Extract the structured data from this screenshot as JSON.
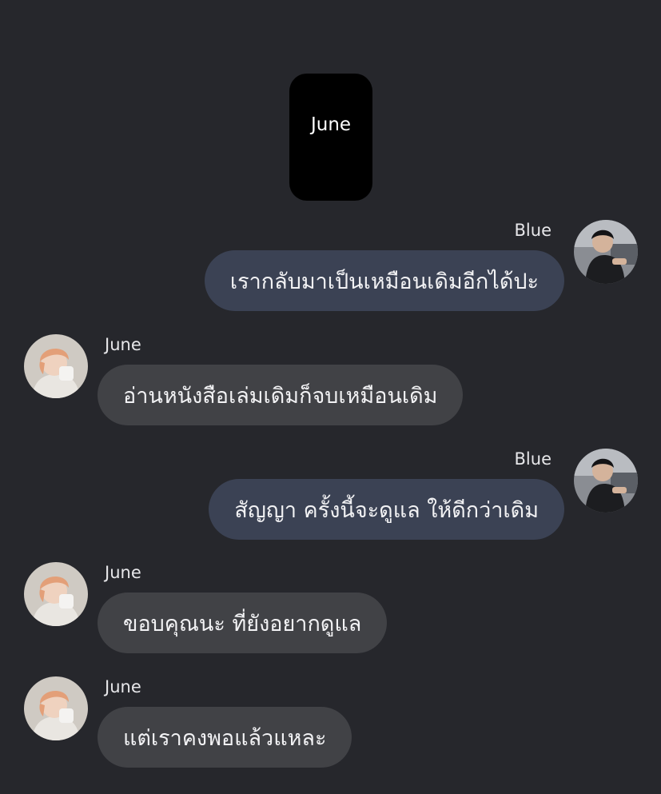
{
  "header": {
    "name": "June"
  },
  "messages": [
    {
      "sender": "Blue",
      "side": "right",
      "text": "เรากลับมาเป็นเหมือนเดิมอีกได้ปะ"
    },
    {
      "sender": "June",
      "side": "left",
      "text": "อ่านหนังสือเล่มเดิมก็จบเหมือนเดิม"
    },
    {
      "sender": "Blue",
      "side": "right",
      "text": "สัญญา ครั้งนี้จะดูแล ให้ดีกว่าเดิม"
    },
    {
      "sender": "June",
      "side": "left",
      "text": "ขอบคุณนะ ที่ยังอยากดูแล"
    },
    {
      "sender": "June",
      "side": "left",
      "text": "แต่เราคงพอแล้วแหละ"
    }
  ],
  "colors": {
    "background": "#26272c",
    "bubble_right": "#3b4254",
    "bubble_left": "#414246",
    "header_card": "#000000"
  }
}
